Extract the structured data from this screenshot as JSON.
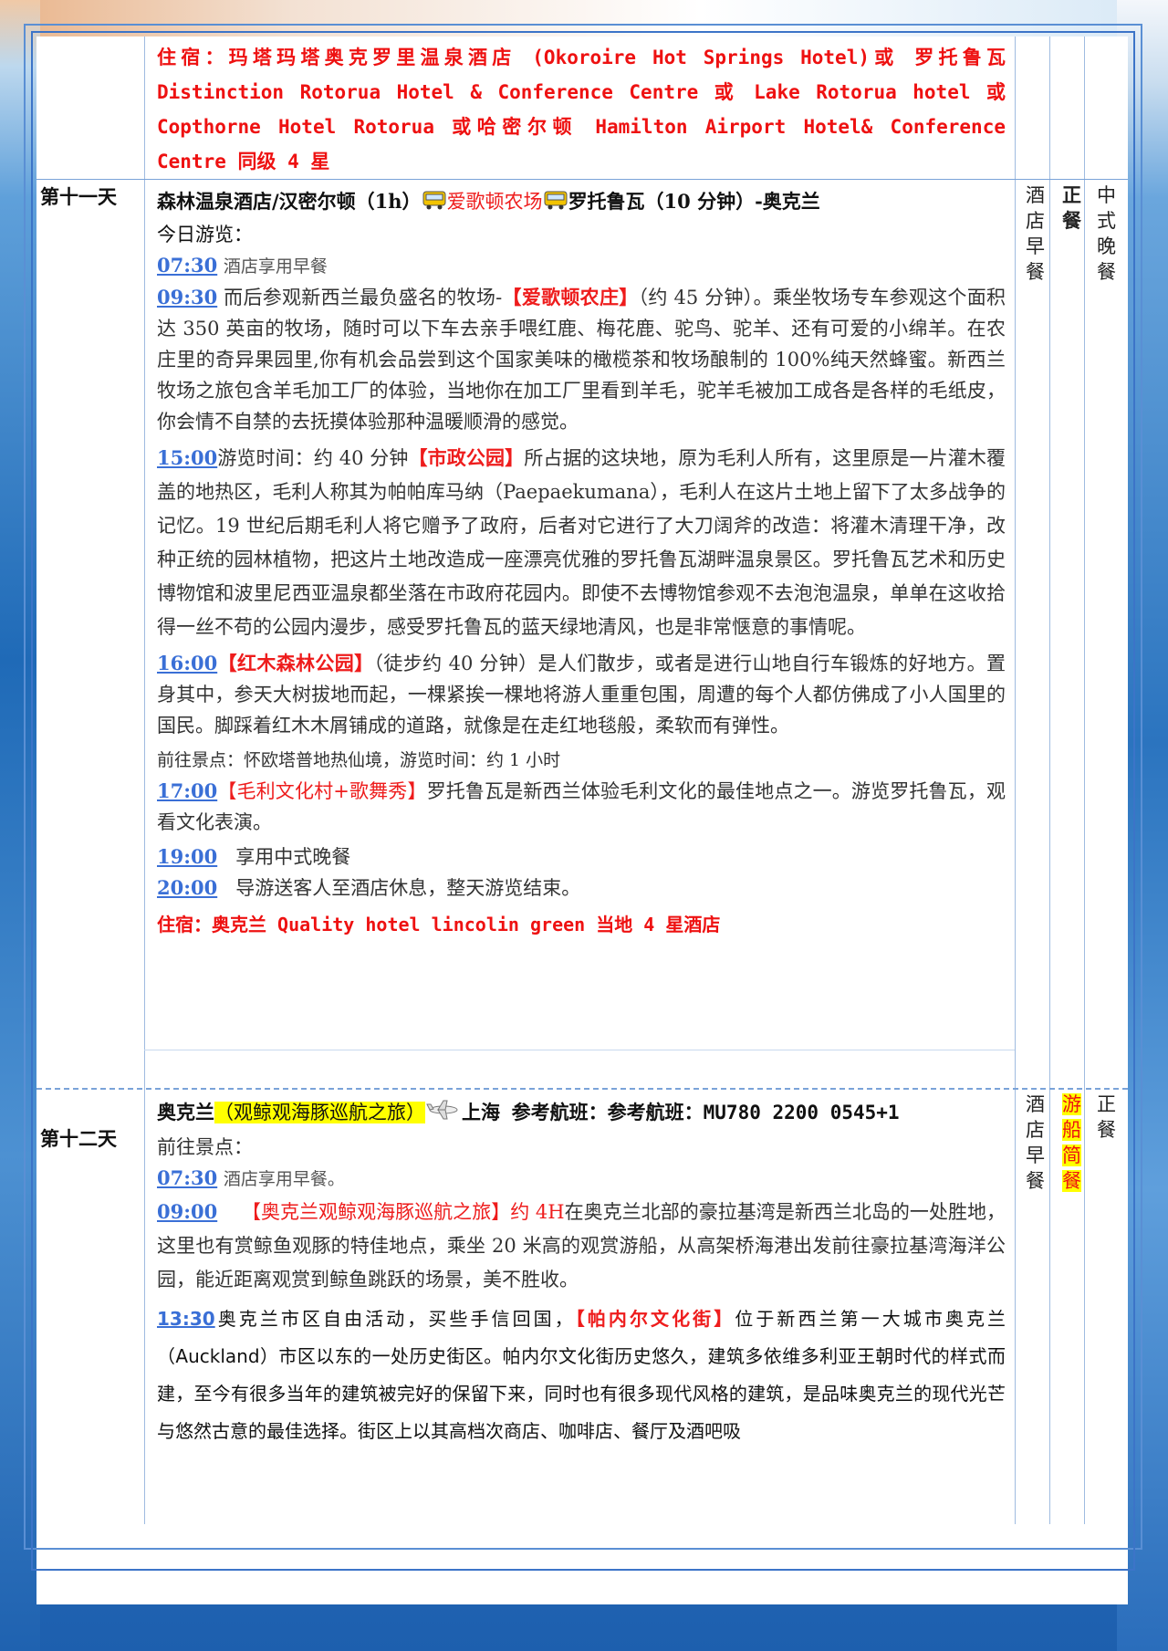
{
  "top_block": {
    "hotel_line": "住宿：玛塔玛塔奥克罗里温泉酒店 (Okoroire Hot Springs Hotel)或 罗托鲁瓦 Distinction Rotorua Hotel & Conference Centre 或 Lake Rotorua hotel 或 Copthorne Hotel Rotorua 或哈密尔顿 Hamilton Airport Hotel& Conference Centre 同级 4 星"
  },
  "day11": {
    "label": "第十一天",
    "route_a": "森林温泉酒店/汉密尔顿（1h）",
    "route_b": "爱歌顿农场",
    "route_c": "罗托鲁瓦（10 分钟）-奥克兰",
    "intro": "今日游览：",
    "items": [
      {
        "time": "07:30",
        "text": "酒店享用早餐"
      },
      {
        "time": "09:30",
        "pre": "而后参观新西兰最负盛名的牧场-",
        "hl": "【爱歌顿农庄】",
        "post": "（约 45 分钟）。乘坐牧场专车参观这个面积达 350 英亩的牧场，随时可以下车去亲手喂红鹿、梅花鹿、驼鸟、驼羊、还有可爱的小绵羊。在农庄里的奇异果园里,你有机会品尝到这个国家美味的橄榄茶和牧场酿制的 100%纯天然蜂蜜。新西兰牧场之旅包含羊毛加工厂的体验，当地你在加工厂里看到羊毛，驼羊毛被加工成各是各样的毛纸皮，你会情不自禁的去抚摸体验那种温暖顺滑的感觉。"
      },
      {
        "time": "15:00",
        "pre": "游览时间：约 40 分钟",
        "hl": "【市政公园】",
        "post": "所占据的这块地，原为毛利人所有，这里原是一片灌木覆盖的地热区，毛利人称其为帕帕库马纳（Paepaekumana），毛利人在这片土地上留下了太多战争的记忆。19 世纪后期毛利人将它赠予了政府，后者对它进行了大刀阔斧的改造：将灌木清理干净，改种正统的园林植物，把这片土地改造成一座漂亮优雅的罗托鲁瓦湖畔温泉景区。罗托鲁瓦艺术和历史博物馆和波里尼西亚温泉都坐落在市政府花园内。即使不去博物馆参观不去泡泡温泉，单单在这收拾得一丝不苟的公园内漫步，感受罗托鲁瓦的蓝天绿地清风，也是非常惬意的事情呢。"
      },
      {
        "time": "16:00",
        "pre": "",
        "hl": "【红木森林公园】",
        "post": "（徒步约 40 分钟）是人们散步，或者是进行山地自行车锻炼的好地方。置身其中，参天大树拔地而起，一棵紧挨一棵地将游人重重包围，周遭的每个人都仿佛成了小人国里的国民。脚踩着红木木屑铺成的道路，就像是在走红地毯般，柔软而有弹性。"
      },
      {
        "time": "",
        "text": "前往景点：怀欧塔普地热仙境，游览时间：约 1 小时"
      },
      {
        "time": "17:00",
        "pre": "",
        "hl": "【毛利文化村+歌舞秀】",
        "post": "罗托鲁瓦是新西兰体验毛利文化的最佳地点之一。游览罗托鲁瓦，观看文化表演。"
      },
      {
        "time": "19:00",
        "text": "享用中式晚餐"
      },
      {
        "time": "20:00",
        "text": "导游送客人至酒店休息，整天游览结束。"
      }
    ],
    "hotel": "住宿：奥克兰 Quality hotel lincolin green 当地 4 星酒店",
    "meal_breakfast": "酒店早餐",
    "meal_lunch": "正餐",
    "meal_dinner": "中式晚餐"
  },
  "day12": {
    "label": "第十二天",
    "route_a": "奥克兰",
    "route_hl": "（观鲸观海豚巡航之旅）",
    "route_b": "上海 参考航班：参考航班：MU780 2200 0545+1",
    "intro": "前往景点：",
    "items": [
      {
        "time": "07:30",
        "text": "酒店享用早餐。"
      },
      {
        "time": "09:00",
        "hl": "【奥克兰观鲸观海豚巡航之旅】约 4H",
        "post": "在奥克兰北部的豪拉基湾是新西兰北岛的一处胜地，这里也有赏鲸鱼观豚的特佳地点，乘坐 20 米高的观赏游船，从高架桥海港出发前往豪拉基湾海洋公园，能近距离观赏到鲸鱼跳跃的场景，美不胜收。"
      },
      {
        "time": "13:30",
        "pre": "奥克兰市区自由活动，买些手信回国，",
        "hl": "【帕内尔文化街】",
        "post": "位于新西兰第一大城市奥克兰（Auckland）市区以东的一处历史街区。帕内尔文化街历史悠久，建筑多依维多利亚王朝时代的样式而建，至今有很多当年的建筑被完好的保留下来，同时也有很多现代风格的建筑，是品味奥克兰的现代光芒与悠然古意的最佳选择。街区上以其高档次商店、咖啡店、餐厅及酒吧吸"
      }
    ],
    "meal_breakfast": "酒店早餐",
    "meal_lunch": "游船简餐",
    "meal_dinner": "正餐"
  }
}
